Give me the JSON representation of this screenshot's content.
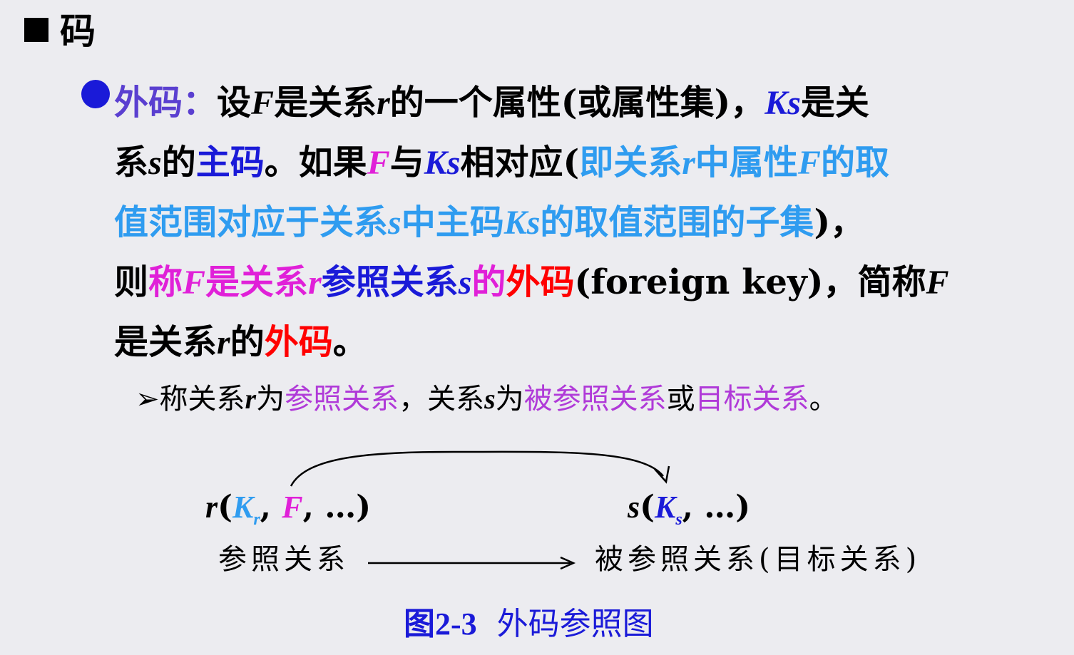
{
  "heading": {
    "marker": "■",
    "title": "码"
  },
  "definition": {
    "term": "外码",
    "colon": "：",
    "l1_a": "设",
    "l1_F": "F",
    "l1_b": "是关系",
    "l1_r": "r",
    "l1_c": "的一个属性(或属性集)，",
    "l1_Ks": "Ks",
    "l1_d": "是关",
    "l2_a": "系",
    "l2_s": "s",
    "l2_b": "的",
    "l2_pk": "主码",
    "l2_c": "。如果",
    "l2_F": "F",
    "l2_d": "与",
    "l2_Ks": "Ks",
    "l2_e": "相对应(",
    "l2_f": "即关系",
    "l2_r": "r",
    "l2_g": "中属性",
    "l2_F2": "F",
    "l2_h": "的取",
    "l3_a": "值范围对应于关系",
    "l3_s": "s",
    "l3_b": "中主码",
    "l3_Ks": "Ks",
    "l3_c": "的取值范围的子集",
    "l3_d": ")，",
    "l4_a": "则",
    "l4_b": "称",
    "l4_F": "F",
    "l4_c": "是关系",
    "l4_r": "r",
    "l4_d": "参照关系",
    "l4_s": "s",
    "l4_e": "的",
    "l4_fk": "外码",
    "l4_f": "(foreign key)，简称",
    "l4_F2": "F",
    "l5_a": "是关系",
    "l5_r": "r",
    "l5_b": "的",
    "l5_fk": "外码",
    "l5_c": "。"
  },
  "note": {
    "arrow": "➢",
    "a": "称关系",
    "r": "r",
    "b": "为",
    "ref": "参照关系",
    "c": "，关系",
    "s": "s",
    "d": "为",
    "refd": "被参照关系",
    "e": "或",
    "target": "目标关系",
    "f": "。"
  },
  "diagram": {
    "r_formula": {
      "r": "r",
      "open": "(",
      "K": "K",
      "sub_r": "r",
      "comma1": ", ",
      "F": "F",
      "rest": ", …)"
    },
    "s_formula": {
      "s": "s",
      "open": "(",
      "K": "K",
      "sub_s": "s",
      "rest": ", …)"
    },
    "left_label": "参照关系",
    "right_label": "被参照关系(目标关系)"
  },
  "caption": {
    "num": "图2-3",
    "text": "外码参照图"
  }
}
